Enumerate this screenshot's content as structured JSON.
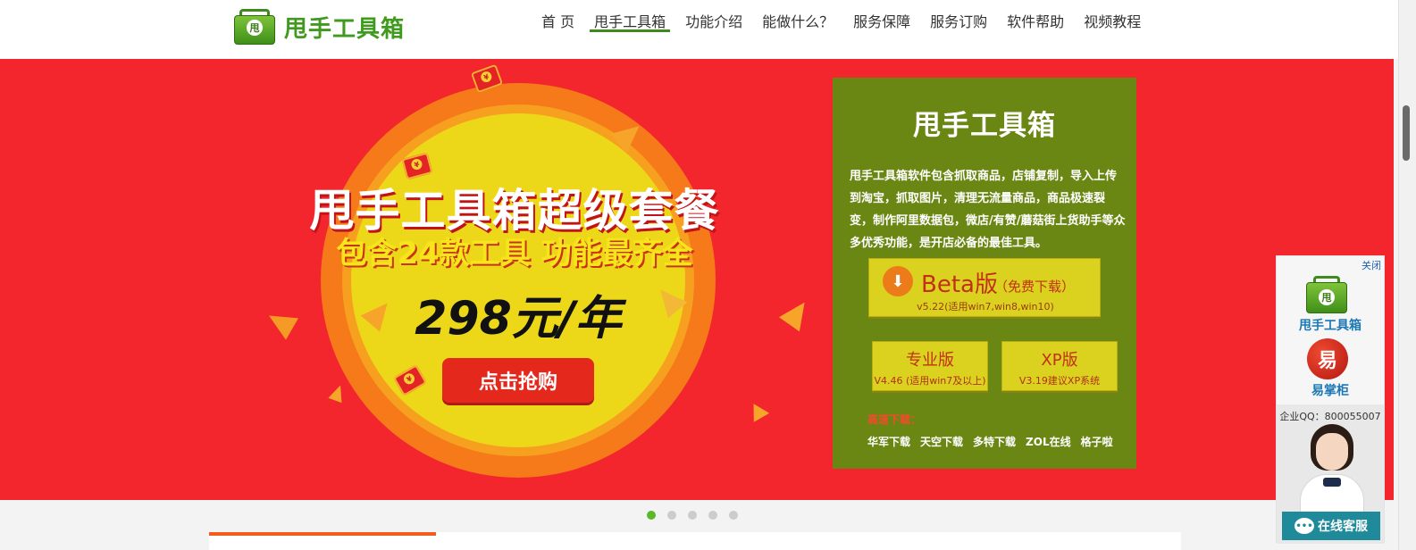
{
  "header": {
    "logo_text": "甩手工具箱",
    "logo_mark": "甩",
    "nav": [
      {
        "label": "首 页",
        "active": false
      },
      {
        "label": "甩手工具箱",
        "active": true
      },
      {
        "label": "功能介绍",
        "active": false
      },
      {
        "label": "能做什么？",
        "active": false
      },
      {
        "label": "服务保障",
        "active": false
      },
      {
        "label": "服务订购",
        "active": false
      },
      {
        "label": "软件帮助",
        "active": false
      },
      {
        "label": "视频教程",
        "active": false
      }
    ]
  },
  "banner": {
    "title": "甩手工具箱超级套餐",
    "subtitle": "包含24款工具 功能最齐全",
    "price": "298元/年",
    "buy_label": "点击抢购"
  },
  "product_card": {
    "title": "甩手工具箱",
    "description": "甩手工具箱软件包含抓取商品，店铺复制，导入上传到淘宝，抓取图片，清理无流量商品，商品极速裂变，制作阿里数据包，微店/有赞/蘑菇街上货助手等众多优秀功能，是开店必备的最佳工具。",
    "beta": {
      "name": "Beta版",
      "note": "（免费下载）",
      "version": "v5.22(适用win7,win8,win10)",
      "icon": "download-icon"
    },
    "pro": {
      "name": "专业版",
      "version": "V4.46 (适用win7及以上)"
    },
    "xp": {
      "name": "XP版",
      "version": "V3.19建议XP系统"
    },
    "mirror_label": "高速下载：",
    "mirrors": [
      "华军下载",
      "天空下载",
      "多特下载",
      "ZOL在线",
      "格子啦"
    ]
  },
  "slider": {
    "count": 5,
    "active_index": 0
  },
  "float_panel": {
    "close_label": "关闭",
    "label1": "甩手工具箱",
    "yi_mark": "易",
    "label2": "易掌柜",
    "qq_text": "企业QQ：800055007",
    "chat_label": "在线客服"
  },
  "colors": {
    "banner_red": "#f2262c",
    "card_green": "#6b8713",
    "button_yellow": "#dbd21f",
    "brand_green": "#3f9a1e",
    "active_dot": "#5bb82a"
  }
}
